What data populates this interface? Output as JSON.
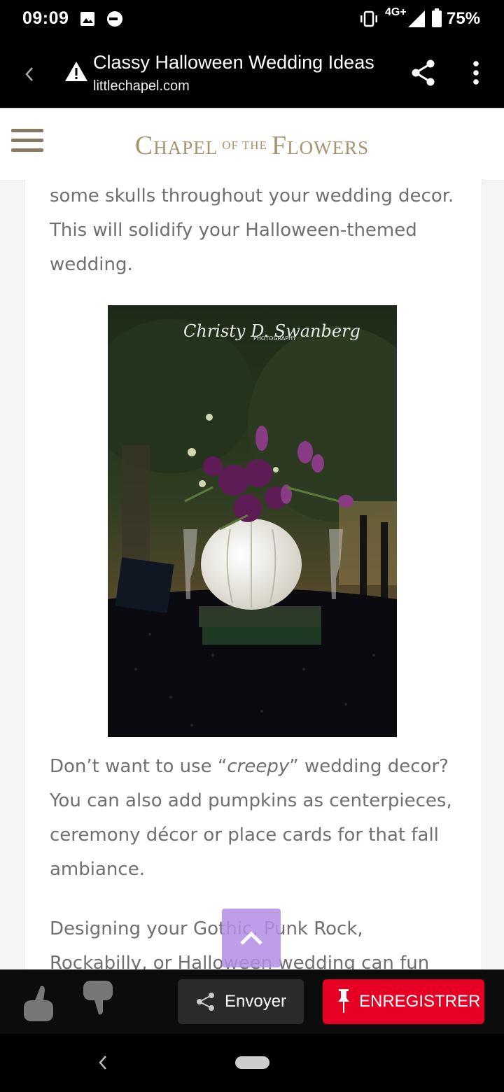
{
  "status_bar": {
    "time": "09:09",
    "network": "4G+",
    "battery": "75%",
    "icons": [
      "image-icon",
      "data-saver-icon",
      "vibrate-icon",
      "signal-icon",
      "battery-icon"
    ]
  },
  "tab_header": {
    "title": "Classy Halloween Wedding Ideas",
    "url": "littlechapel.com",
    "icons": [
      "back-icon",
      "warning-icon",
      "share-icon",
      "more-vert-icon"
    ]
  },
  "site": {
    "logo": {
      "part1": "Chapel",
      "part2": "of the",
      "part3": "Flowers"
    },
    "logo_color": "#a8936f"
  },
  "article": {
    "para1": "some skulls throughout your wedding decor. This will solidify your Halloween-themed wedding.",
    "photo_watermark": "Christy D. Swanberg",
    "photo_watermark_sub": "PHOTOGRAPHY",
    "para2_before": "Don’t want to use “",
    "para2_em": "creepy",
    "para2_after": "” wedding decor? You can also add pumpkins as centerpieces, ceremony décor or place cards for that fall ambiance.",
    "para3": "Designing your Gothic, Punk Rock, Rockabilly, or Halloween wedding can fun"
  },
  "bottom_bar": {
    "send_label": "Envoyer",
    "save_label": "ENREGISTRER",
    "save_color": "#e60023"
  }
}
